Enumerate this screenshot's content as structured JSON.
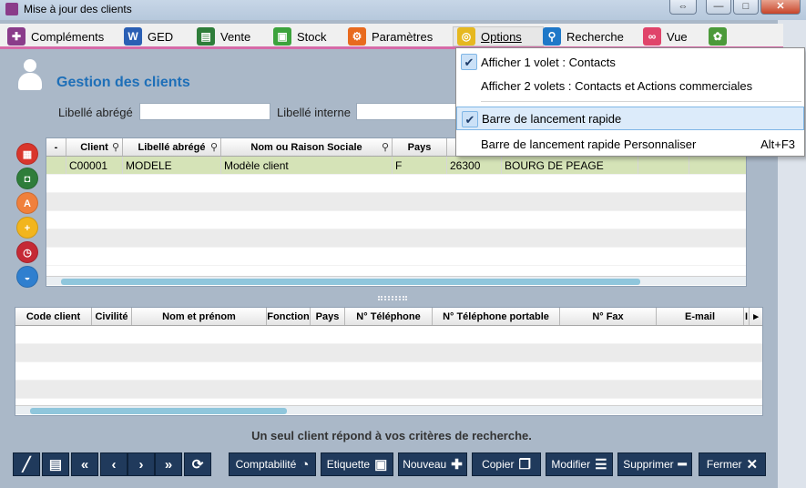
{
  "window": {
    "title": "Mise à jour des clients",
    "close_glyph": "✕",
    "max_glyph": "□",
    "min_glyph": "—",
    "swap_glyph": "⇔"
  },
  "menu": {
    "items": [
      {
        "label": "Compléments",
        "icon": "puzzle-icon",
        "color": "#8a3c8a",
        "glyph": "✚"
      },
      {
        "label": "GED",
        "icon": "word-doc-icon",
        "color": "#2b5fb4",
        "glyph": "W"
      },
      {
        "label": "Vente",
        "icon": "ledger-icon",
        "color": "#2f7d3a",
        "glyph": "▤"
      },
      {
        "label": "Stock",
        "icon": "cart-icon",
        "color": "#3da33d",
        "glyph": "▣"
      },
      {
        "label": "Paramètres",
        "icon": "gear-icon",
        "color": "#e86a1e",
        "glyph": "⚙"
      },
      {
        "label": "Options",
        "icon": "glasses-icon",
        "color": "#e6b820",
        "glyph": "◎"
      },
      {
        "label": "Recherche",
        "icon": "magnifier-icon",
        "color": "#1f78c8",
        "glyph": "⚲"
      },
      {
        "label": "Vue",
        "icon": "binoculars-icon",
        "color": "#e0446a",
        "glyph": "∞"
      },
      {
        "label": "",
        "icon": "palette-icon",
        "color": "#4c9a3a",
        "glyph": "✿"
      }
    ]
  },
  "page": {
    "title": "Gestion des clients",
    "status": "Un seul client répond à vos critères de recherche."
  },
  "filters": {
    "libelle_abrege_label": "Libellé abrégé",
    "libelle_interne_label": "Libellé interne",
    "libelle_abrege_value": "",
    "libelle_interne_value": ""
  },
  "sidebar": [
    {
      "icon": "card-icon",
      "color": "#d9362c",
      "glyph": "▦"
    },
    {
      "icon": "safe-icon",
      "color": "#2f7d3a",
      "glyph": "◘"
    },
    {
      "icon": "font-a-icon",
      "color": "#f0803c",
      "glyph": "A"
    },
    {
      "icon": "add-user-icon",
      "color": "#f2b51d",
      "glyph": "+"
    },
    {
      "icon": "alarm-clock-icon",
      "color": "#c52a35",
      "glyph": "◷"
    },
    {
      "icon": "basket-icon",
      "color": "#2f7fcf",
      "glyph": "◒"
    }
  ],
  "clients_grid": {
    "columns": [
      "-",
      "Client",
      "Libellé abrégé",
      "Nom ou Raison Sociale",
      "Pays",
      "",
      "",
      "",
      ""
    ],
    "rows": [
      [
        "",
        "C00001",
        "MODELE",
        "Modèle client",
        "F",
        "26300",
        "BOURG DE PEAGE",
        "",
        ""
      ]
    ],
    "search_glyph": "⚲"
  },
  "contacts_grid": {
    "columns": [
      "Code client",
      "Civilité",
      "Nom et prénom",
      "Fonction",
      "Pays",
      "N° Téléphone",
      "N° Téléphone portable",
      "N° Fax",
      "E-mail",
      "I",
      "▸"
    ],
    "rows": []
  },
  "toolbar": {
    "icons": [
      {
        "icon": "pen-icon",
        "glyph": "╱"
      },
      {
        "icon": "printer-icon",
        "glyph": "▤"
      },
      {
        "icon": "first-icon",
        "glyph": "«"
      },
      {
        "icon": "prev-icon",
        "glyph": "‹"
      },
      {
        "icon": "next-icon",
        "glyph": "›"
      },
      {
        "icon": "last-icon",
        "glyph": "»"
      },
      {
        "icon": "refresh-icon",
        "glyph": "⟳"
      }
    ],
    "buttons": [
      {
        "label": "Comptabilité",
        "glyph": "◔",
        "icon": "pie-icon"
      },
      {
        "label": "Etiquette",
        "glyph": "▣",
        "icon": "label-icon"
      },
      {
        "label": "Nouveau",
        "glyph": "✚",
        "icon": "plus-icon"
      },
      {
        "label": "Copier",
        "glyph": "❐",
        "icon": "copy-icon"
      },
      {
        "label": "Modifier",
        "glyph": "☰",
        "icon": "edit-list-icon"
      },
      {
        "label": "Supprimer",
        "glyph": "━",
        "icon": "minus-icon"
      },
      {
        "label": "Fermer",
        "glyph": "✕",
        "icon": "close-icon"
      }
    ]
  },
  "options_menu": {
    "check_glyph": "✔",
    "items": [
      {
        "label": "Afficher 1 volet : Contacts",
        "checked": true,
        "accel": ""
      },
      {
        "label": "Afficher 2 volets : Contacts et Actions commerciales",
        "checked": false,
        "accel": ""
      },
      {
        "label": "Barre de lancement rapide",
        "checked": true,
        "accel": ""
      },
      {
        "label": "Barre de lancement rapide Personnaliser",
        "checked": false,
        "accel": "Alt+F3"
      }
    ]
  }
}
